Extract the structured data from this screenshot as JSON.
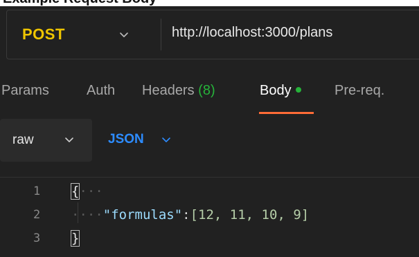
{
  "header": {
    "cut_heading": "Example Request Body"
  },
  "request": {
    "method": "POST",
    "method_color": "#f0c600",
    "url": "http://localhost:3000/plans"
  },
  "tabs": [
    {
      "label": "Params"
    },
    {
      "label": "Auth"
    },
    {
      "label": "Headers",
      "count": "(8)"
    },
    {
      "label": "Body",
      "active": true
    },
    {
      "label": "Pre-req."
    }
  ],
  "body_options": {
    "mode": "raw",
    "language": "JSON",
    "language_color": "#2d8cff"
  },
  "accent_color": "#ff6c37",
  "status_dot_color": "#26b33a",
  "editor": {
    "lines": [
      {
        "number": "1",
        "text": "{"
      },
      {
        "number": "2",
        "key": "\"formulas\"",
        "value": "[12, 11, 10, 9]"
      },
      {
        "number": "3",
        "text": "}"
      }
    ]
  },
  "icons": {
    "method_dropdown": "chevron-down-icon",
    "mode_dropdown": "chevron-down-icon",
    "language_dropdown": "chevron-down-icon"
  }
}
